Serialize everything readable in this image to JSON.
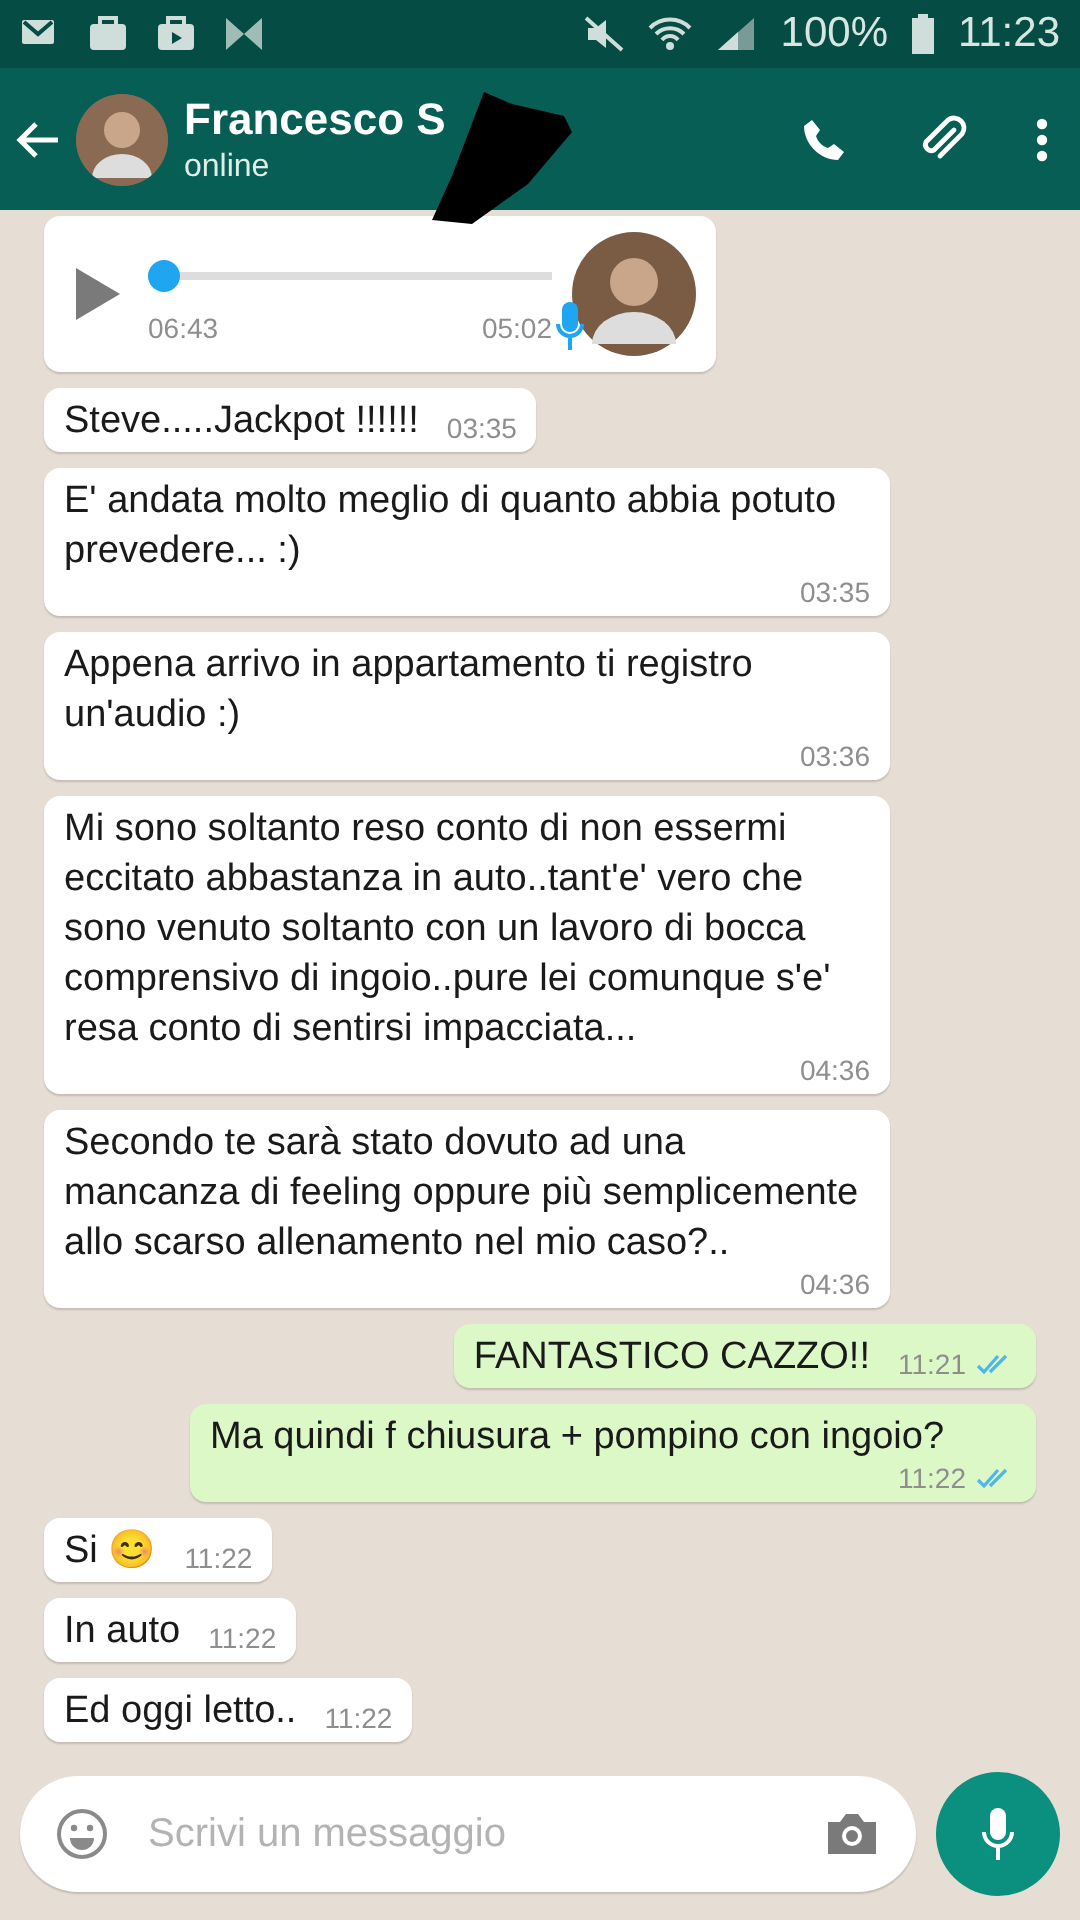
{
  "status_bar": {
    "battery": "100%",
    "time": "11:23"
  },
  "header": {
    "contact_name": "Francesco S",
    "status": "online"
  },
  "voice_message": {
    "level": 0,
    "position": "06:43",
    "duration": "05:02"
  },
  "messages": [
    {
      "kind": "incoming",
      "text": "Steve.....Jackpot !!!!!!",
      "time": "03:35"
    },
    {
      "kind": "incoming",
      "text": "E' andata molto meglio di quanto abbia potuto prevedere... :)",
      "time": "03:35"
    },
    {
      "kind": "incoming",
      "text": "Appena arrivo in appartamento ti registro un'audio :)",
      "time": "03:36"
    },
    {
      "kind": "incoming",
      "text": "Mi sono soltanto reso conto di non essermi eccitato abbastanza in auto..tant'e' vero che sono venuto soltanto con un lavoro di bocca comprensivo di ingoio..pure lei comunque s'e' resa conto di sentirsi impacciata...",
      "time": "04:36"
    },
    {
      "kind": "incoming",
      "text": "Secondo te sarà stato dovuto ad una mancanza di feeling oppure più semplicemente allo scarso allenamento nel mio caso?..",
      "time": "04:36"
    },
    {
      "kind": "outgoing",
      "text": "FANTASTICO CAZZO!!",
      "time": "11:21",
      "read": true
    },
    {
      "kind": "outgoing",
      "text": "Ma quindi f chiusura + pompino con ingoio?",
      "time": "11:22",
      "read": true
    },
    {
      "kind": "incoming",
      "text": "Si 😊",
      "time": "11:22"
    },
    {
      "kind": "incoming",
      "text": "In auto",
      "time": "11:22"
    },
    {
      "kind": "incoming",
      "text": "Ed oggi letto..",
      "time": "11:22"
    }
  ],
  "composer": {
    "placeholder": "Scrivi un messaggio"
  }
}
